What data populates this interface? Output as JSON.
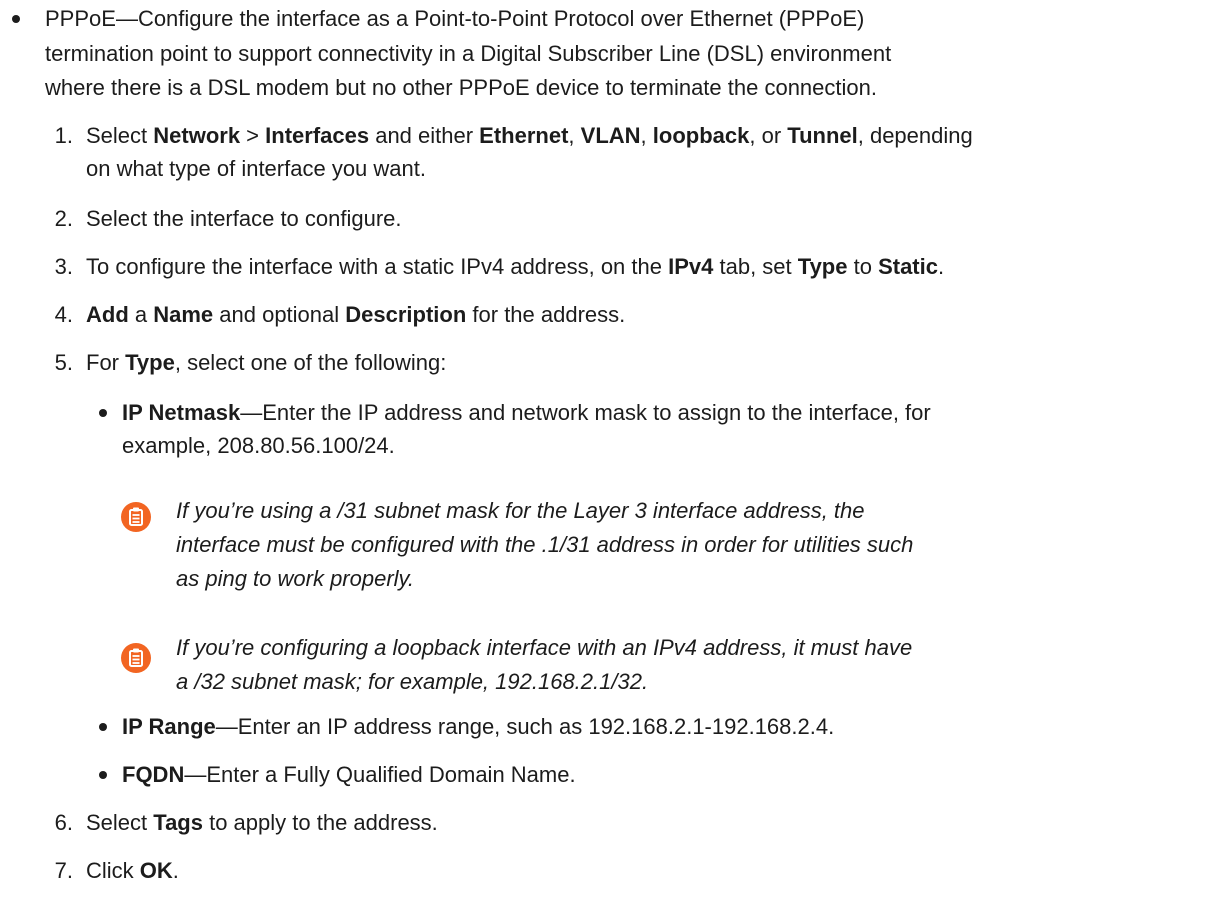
{
  "intro": {
    "label": "PPPoE",
    "dash": "—",
    "line1": "Configure the interface as a Point-to-Point Protocol over Ethernet (PPPoE)",
    "line2": "termination point to support connectivity in a Digital Subscriber Line (DSL) environment",
    "line3": "where there is a DSL modem but no other PPPoE device to terminate the connection."
  },
  "steps": {
    "s1": {
      "num": "1.",
      "a": "Select ",
      "b1": "Network",
      "c": " > ",
      "b2": "Interfaces",
      "d": " and either ",
      "b3": "Ethernet",
      "e": ", ",
      "b4": "VLAN",
      "f": ", ",
      "b5": "loopback",
      "g": ", or ",
      "b6": "Tunnel",
      "h": ", depending",
      "line2": "on what type of interface you want."
    },
    "s2": {
      "num": "2.",
      "text": "Select the interface to configure."
    },
    "s3": {
      "num": "3.",
      "a": "To configure the interface with a static IPv4 address, on the ",
      "b1": "IPv4",
      "c": " tab, set ",
      "b2": "Type",
      "d": " to ",
      "b3": "Static",
      "e": "."
    },
    "s4": {
      "num": "4.",
      "b1": "Add",
      "a": " a ",
      "b2": "Name",
      "c": " and optional ",
      "b3": "Description",
      "d": " for the address."
    },
    "s5": {
      "num": "5.",
      "a": "For ",
      "b1": "Type",
      "c": ", select one of the following:"
    },
    "s6": {
      "num": "6.",
      "a": "Select ",
      "b1": "Tags",
      "c": " to apply to the address."
    },
    "s7": {
      "num": "7.",
      "a": "Click ",
      "b1": "OK",
      "c": "."
    }
  },
  "types": {
    "netmask": {
      "label": "IP Netmask",
      "text": "—Enter the IP address and network mask to assign to the interface, for",
      "line2": "example, 208.80.56.100/24."
    },
    "range": {
      "label": "IP Range",
      "text": "—Enter an IP address range, such as 192.168.2.1-192.168.2.4."
    },
    "fqdn": {
      "label": "FQDN",
      "text": "—Enter a Fully Qualified Domain Name."
    }
  },
  "notes": {
    "n1": {
      "line1": "If you’re using a /31 subnet mask for the Layer 3 interface address, the",
      "line2": "interface must be configured with the .1/31 address in order for utilities such",
      "line3": "as ping to work properly."
    },
    "n2": {
      "line1": "If you’re configuring a loopback interface with an IPv4 address, it must have",
      "line2": "a /32 subnet mask; for example, 192.168.2.1/32."
    }
  },
  "colors": {
    "note_icon": "#f26522",
    "text": "#1c1c1c"
  },
  "icons": {
    "note": "clipboard-note-icon"
  }
}
